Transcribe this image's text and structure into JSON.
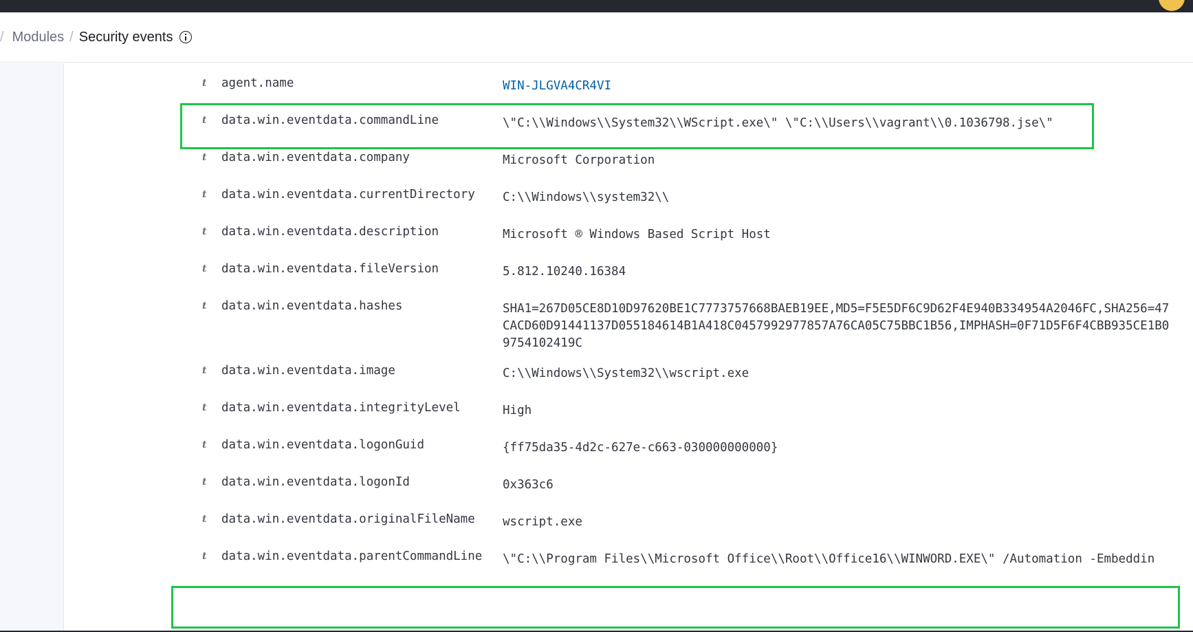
{
  "breadcrumb": {
    "separator": "/",
    "parent": "Modules",
    "current": "Security events"
  },
  "colors": {
    "topbar": "#25282f",
    "highlight": "#1fc447",
    "link": "#0061a6"
  },
  "fields": [
    {
      "type": "t",
      "name": "agent.name",
      "value": "WIN-JLGVA4CR4VI"
    },
    {
      "type": "t",
      "name": "data.win.eventdata.commandLine",
      "value": "\\\"C:\\\\Windows\\\\System32\\\\WScript.exe\\\" \\\"C:\\\\Users\\\\vagrant\\\\0.1036798.jse\\\""
    },
    {
      "type": "t",
      "name": "data.win.eventdata.company",
      "value": "Microsoft Corporation"
    },
    {
      "type": "t",
      "name": "data.win.eventdata.currentDirectory",
      "value": "C:\\\\Windows\\\\system32\\\\"
    },
    {
      "type": "t",
      "name": "data.win.eventdata.description",
      "value": "Microsoft ® Windows Based Script Host"
    },
    {
      "type": "t",
      "name": "data.win.eventdata.fileVersion",
      "value": "5.812.10240.16384"
    },
    {
      "type": "t",
      "name": "data.win.eventdata.hashes",
      "value": "SHA1=267D05CE8D10D97620BE1C7773757668BAEB19EE,MD5=F5E5DF6C9D62F4E940B334954A2046FC,SHA256=47CACD60D91441137D055184614B1A418C0457992977857A76CA05C75BBC1B56,IMPHASH=0F71D5F6F4CBB935CE1B09754102419C"
    },
    {
      "type": "t",
      "name": "data.win.eventdata.image",
      "value": "C:\\\\Windows\\\\System32\\\\wscript.exe"
    },
    {
      "type": "t",
      "name": "data.win.eventdata.integrityLevel",
      "value": "High"
    },
    {
      "type": "t",
      "name": "data.win.eventdata.logonGuid",
      "value": "{ff75da35-4d2c-627e-c663-030000000000}"
    },
    {
      "type": "t",
      "name": "data.win.eventdata.logonId",
      "value": "0x363c6"
    },
    {
      "type": "t",
      "name": "data.win.eventdata.originalFileName",
      "value": "wscript.exe"
    },
    {
      "type": "t",
      "name": "data.win.eventdata.parentCommandLine",
      "value": "\\\"C:\\\\Program Files\\\\Microsoft Office\\\\Root\\\\Office16\\\\WINWORD.EXE\\\" /Automation -Embeddin"
    }
  ]
}
